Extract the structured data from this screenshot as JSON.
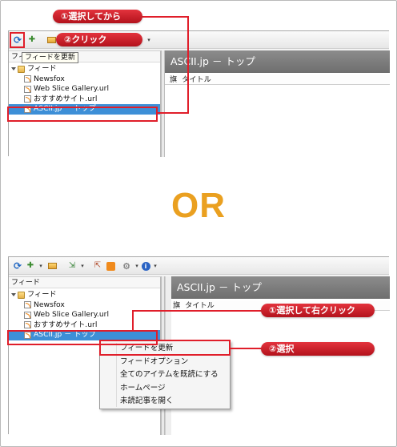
{
  "top": {
    "tooltip": "フィードを更新",
    "tree_header_partial": "フィ",
    "nodes": [
      {
        "label": "フィード",
        "kind": "folder"
      },
      {
        "label": "Newsfox",
        "kind": "rss"
      },
      {
        "label": "Web Slice Gallery.url",
        "kind": "rss"
      },
      {
        "label": "おすすめサイト.url",
        "kind": "rss"
      },
      {
        "label": "ASCII.jp － トップ",
        "kind": "rss",
        "selected": true
      }
    ],
    "pane_title": "ASCII.jp － トップ",
    "col_flag": "旗",
    "col_title": "タイトル",
    "callout1": "①選択してから",
    "callout2": "②クリック"
  },
  "or_text": "OR",
  "bottom": {
    "tree_header": "フィード",
    "nodes": [
      {
        "label": "フィード",
        "kind": "folder"
      },
      {
        "label": "Newsfox",
        "kind": "rss"
      },
      {
        "label": "Web Slice Gallery.url",
        "kind": "rss"
      },
      {
        "label": "おすすめサイト.url",
        "kind": "rss"
      },
      {
        "label": "ASCII.jp － トップ",
        "kind": "rss",
        "selected": true
      }
    ],
    "pane_title": "ASCII.jp － トップ",
    "col_flag": "旗",
    "col_title": "タイトル",
    "menu_items": [
      "フィードを更新",
      "フィードオプション",
      "全てのアイテムを既読にする",
      "ホームページ",
      "未読記事を開く"
    ],
    "callout1": "①選択して右クリック",
    "callout2": "②選択"
  },
  "colors": {
    "accent_red": "#e01e2a",
    "or_orange": "#eaa020",
    "selection_blue": "#3d8fd7",
    "title_gray": "#7a7a7a"
  },
  "icons": [
    "refresh-icon",
    "add-feed-icon",
    "folder-icon",
    "import-icon",
    "export-icon",
    "rss-icon",
    "gear-icon",
    "info-icon",
    "chevron-down-icon"
  ]
}
